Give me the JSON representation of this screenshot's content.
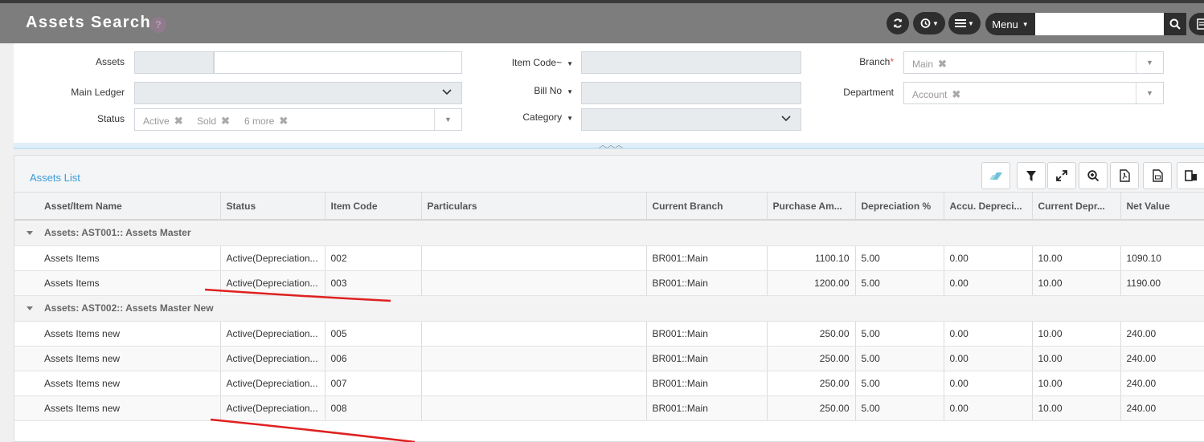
{
  "header": {
    "title": "Assets Search",
    "help_glyph": "?",
    "menu_label": "Menu",
    "search_placeholder": ""
  },
  "filters": {
    "assets_label": "Assets",
    "main_ledger_label": "Main Ledger",
    "status_label": "Status",
    "status_tags": [
      "Active",
      "Sold",
      "6 more"
    ],
    "item_code_label": "Item Code~",
    "bill_no_label": "Bill No",
    "category_label": "Category",
    "branch_label": "Branch",
    "branch_required": "*",
    "branch_tag": "Main",
    "department_label": "Department",
    "department_tag": "Account"
  },
  "list": {
    "title": "Assets List",
    "columns": [
      "Asset/Item Name",
      "Status",
      "Item Code",
      "Particulars",
      "Current Branch",
      "Purchase Am...",
      "Depreciation %",
      "Accu. Depreci...",
      "Current Depr...",
      "Net Value"
    ],
    "groups": [
      {
        "label": "Assets: AST001:: Assets Master",
        "rows": [
          [
            "Assets Items",
            "Active(Depreciation...",
            "002",
            "",
            "BR001::Main",
            "1100.10",
            "5.00",
            "0.00",
            "10.00",
            "1090.10"
          ],
          [
            "Assets Items",
            "Active(Depreciation...",
            "003",
            "",
            "BR001::Main",
            "1200.00",
            "5.00",
            "0.00",
            "10.00",
            "1190.00"
          ]
        ]
      },
      {
        "label": "Assets: AST002:: Assets Master New",
        "rows": [
          [
            "Assets Items new",
            "Active(Depreciation...",
            "005",
            "",
            "BR001::Main",
            "250.00",
            "5.00",
            "0.00",
            "10.00",
            "240.00"
          ],
          [
            "Assets Items new",
            "Active(Depreciation...",
            "006",
            "",
            "BR001::Main",
            "250.00",
            "5.00",
            "0.00",
            "10.00",
            "240.00"
          ],
          [
            "Assets Items new",
            "Active(Depreciation...",
            "007",
            "",
            "BR001::Main",
            "250.00",
            "5.00",
            "0.00",
            "10.00",
            "240.00"
          ],
          [
            "Assets Items new",
            "Active(Depreciation...",
            "008",
            "",
            "BR001::Main",
            "250.00",
            "5.00",
            "0.00",
            "10.00",
            "240.00"
          ]
        ]
      }
    ]
  },
  "colors": {
    "titlebar": "#7d7d7d",
    "accent_link": "#3a9ad9",
    "annotation_red": "#e02020"
  }
}
